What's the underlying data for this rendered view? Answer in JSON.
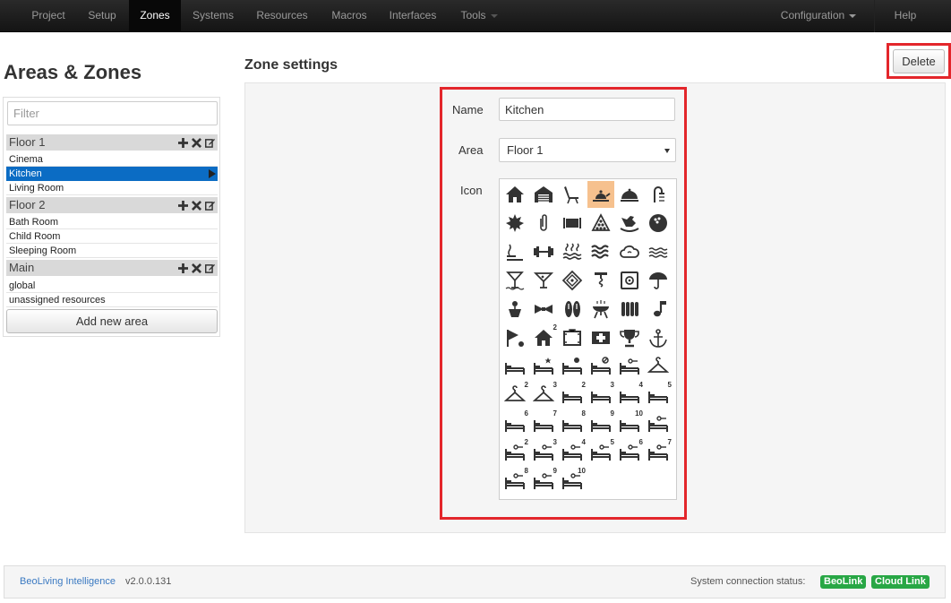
{
  "nav": {
    "items": [
      {
        "label": "Project"
      },
      {
        "label": "Setup"
      },
      {
        "label": "Zones"
      },
      {
        "label": "Systems"
      },
      {
        "label": "Resources"
      },
      {
        "label": "Macros"
      },
      {
        "label": "Interfaces"
      },
      {
        "label": "Tools"
      }
    ],
    "active": "Zones",
    "configuration_label": "Configuration",
    "help_label": "Help"
  },
  "left": {
    "title": "Areas & Zones",
    "filter_placeholder": "Filter",
    "areas": [
      {
        "name": "Floor 1",
        "zones": [
          "Cinema",
          "Kitchen",
          "Living Room"
        ]
      },
      {
        "name": "Floor 2",
        "zones": [
          "Bath Room",
          "Child Room",
          "Sleeping Room"
        ]
      },
      {
        "name": "Main",
        "zones": [
          "global",
          "unassigned resources"
        ]
      }
    ],
    "selected_zone": "Kitchen",
    "add_area_label": "Add new area"
  },
  "zone_settings": {
    "title": "Zone settings",
    "delete_label": "Delete",
    "name_label": "Name",
    "name_value": "Kitchen",
    "area_label": "Area",
    "area_value": "Floor 1",
    "icon_label": "Icon",
    "icons": [
      "house-icon",
      "garage-icon",
      "lounge-chair-icon",
      "kettle-icon",
      "cloche-icon",
      "shower-icon",
      "maple-leaf-icon",
      "paperclip-icon",
      "cinema-screen-icon",
      "billiards-icon",
      "rocking-horse-icon",
      "bowling-ball-icon",
      "sauna-icon",
      "dumbbell-icon",
      "hot-spring-icon",
      "waves-icon",
      "cloud-icon",
      "water-icon",
      "cocktail-icon",
      "martini-icon",
      "tiles-icon",
      "corkscrew-icon",
      "safe-icon",
      "umbrella-icon",
      "flower-pot-icon",
      "bowtie-icon",
      "flip-flops-icon",
      "barbecue-icon",
      "radiator-icon",
      "music-note-icon",
      "flag-icon",
      "house-2-icon",
      "frame-icon",
      "first-aid-icon",
      "trophy-icon",
      "anchor-icon",
      "bed-icon",
      "bed-star-icon",
      "bed-gear-icon",
      "bed-no-icon",
      "bed-key-icon",
      "hanger-icon",
      "hanger-2-icon",
      "hanger-3-icon",
      "bed-2-icon",
      "bed-3-icon",
      "bed-4-icon",
      "bed-5-icon",
      "bed-6-icon",
      "bed-7-icon",
      "bed-8-icon",
      "bed-9-icon",
      "bed-10-icon",
      "bed-key-2-icon",
      "bed-key-2b-icon",
      "bed-key-3-icon",
      "bed-key-4-icon",
      "bed-key-5-icon",
      "bed-key-6-icon",
      "bed-key-7-icon",
      "bed-key-8-icon",
      "bed-key-9-icon",
      "bed-key-10-icon"
    ],
    "icon_badges": [
      "",
      "",
      "",
      "",
      "",
      "",
      "",
      "",
      "",
      "",
      "",
      "",
      "",
      "",
      "",
      "",
      "",
      "",
      "",
      "",
      "",
      "",
      "",
      "",
      "",
      "",
      "",
      "",
      "",
      "",
      "",
      "2",
      "",
      "",
      "",
      "",
      "",
      "",
      "",
      "",
      "",
      "",
      "2",
      "3",
      "2",
      "3",
      "4",
      "5",
      "6",
      "7",
      "8",
      "9",
      "10",
      "",
      "2",
      "3",
      "4",
      "5",
      "6",
      "7",
      "8",
      "9",
      "10"
    ],
    "selected_icon": "kettle-icon"
  },
  "footer": {
    "app_link": "BeoLiving Intelligence",
    "version": "v2.0.0.131",
    "status_label": "System connection status:",
    "badges": [
      "BeoLink",
      "Cloud Link"
    ]
  }
}
